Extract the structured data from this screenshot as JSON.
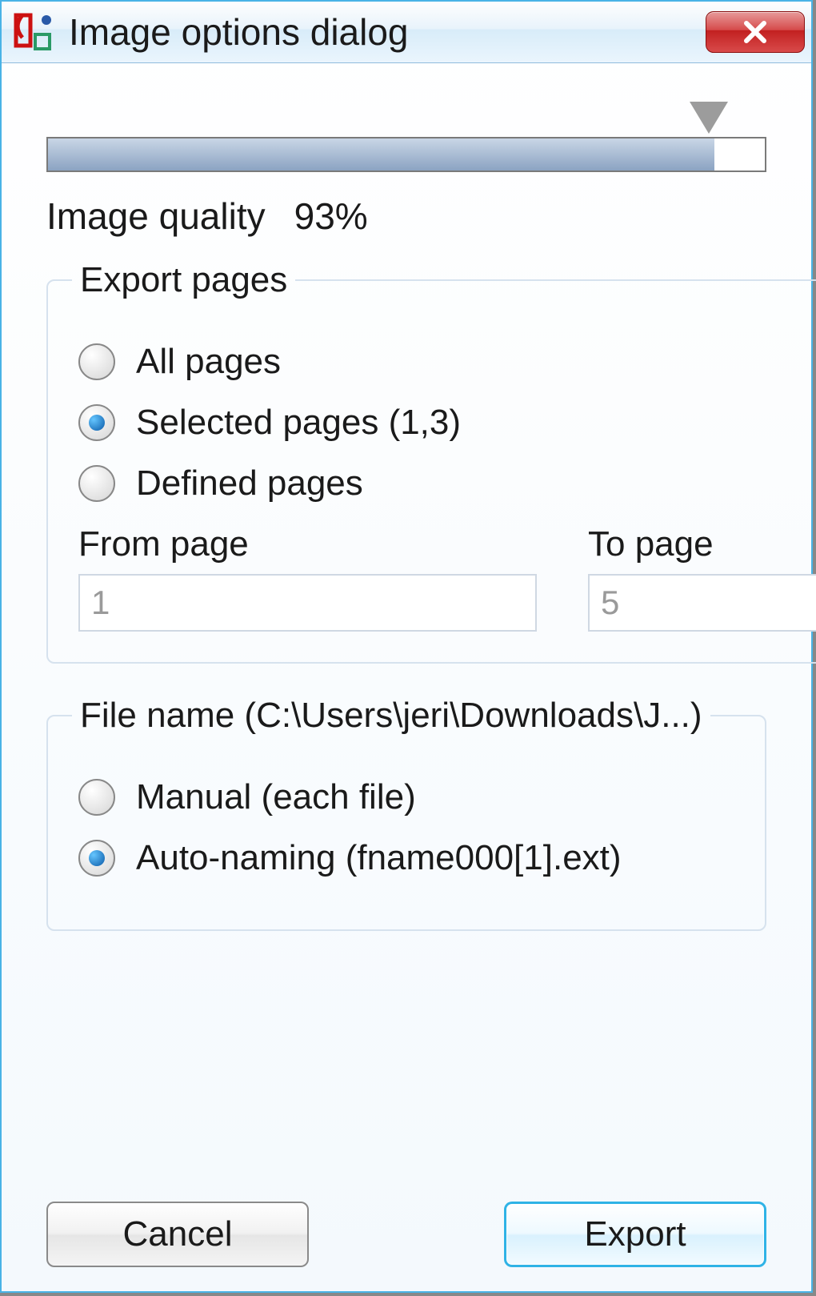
{
  "title": "Image options dialog",
  "slider": {
    "percent": 93,
    "thumb_left_pct": 92
  },
  "quality": {
    "label": "Image quality",
    "value": "93%"
  },
  "export_pages": {
    "legend": "Export pages",
    "options": {
      "all": "All pages",
      "selected": "Selected pages (1,3)",
      "defined": "Defined pages"
    },
    "from_label": "From page",
    "from_value": "1",
    "to_label": "To page",
    "to_value": "5"
  },
  "file_name": {
    "legend": "File name (C:\\Users\\jeri\\Downloads\\J...)",
    "options": {
      "manual": "Manual (each file)",
      "auto": "Auto-naming (fname000[1].ext)"
    }
  },
  "buttons": {
    "cancel": "Cancel",
    "export": "Export"
  }
}
